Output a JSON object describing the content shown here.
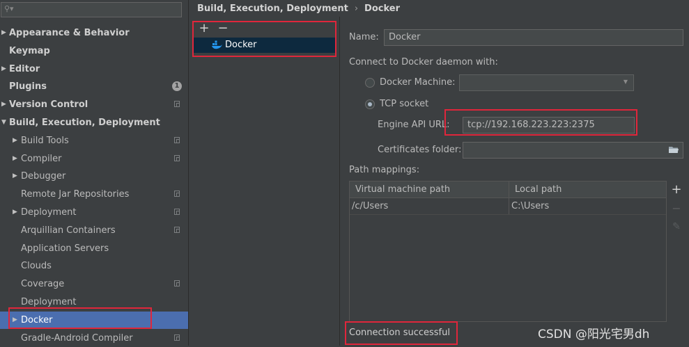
{
  "search": {
    "placeholder": ""
  },
  "sidebar": {
    "items": [
      {
        "label": "Appearance & Behavior",
        "bold": true,
        "arrow": "right",
        "indent": 0
      },
      {
        "label": "Keymap",
        "bold": true,
        "arrow": "",
        "indent": 0
      },
      {
        "label": "Editor",
        "bold": true,
        "arrow": "right",
        "indent": 0
      },
      {
        "label": "Plugins",
        "bold": true,
        "arrow": "",
        "indent": 0,
        "badge": "1"
      },
      {
        "label": "Version Control",
        "bold": true,
        "arrow": "right",
        "indent": 0,
        "copy_icon": true
      },
      {
        "label": "Build, Execution, Deployment",
        "bold": true,
        "arrow": "down",
        "indent": 0
      },
      {
        "label": "Build Tools",
        "bold": false,
        "arrow": "right",
        "indent": 1,
        "copy_icon": true
      },
      {
        "label": "Compiler",
        "bold": false,
        "arrow": "right",
        "indent": 1,
        "copy_icon": true
      },
      {
        "label": "Debugger",
        "bold": false,
        "arrow": "right",
        "indent": 1
      },
      {
        "label": "Remote Jar Repositories",
        "bold": false,
        "arrow": "",
        "indent": 1,
        "copy_icon": true
      },
      {
        "label": "Deployment",
        "bold": false,
        "arrow": "right",
        "indent": 1,
        "copy_icon": true
      },
      {
        "label": "Arquillian Containers",
        "bold": false,
        "arrow": "",
        "indent": 1,
        "copy_icon": true
      },
      {
        "label": "Application Servers",
        "bold": false,
        "arrow": "",
        "indent": 1
      },
      {
        "label": "Clouds",
        "bold": false,
        "arrow": "",
        "indent": 1
      },
      {
        "label": "Coverage",
        "bold": false,
        "arrow": "",
        "indent": 1,
        "copy_icon": true
      },
      {
        "label": "Deployment",
        "bold": false,
        "arrow": "",
        "indent": 1
      },
      {
        "label": "Docker",
        "bold": false,
        "arrow": "right",
        "indent": 1,
        "selected": true
      },
      {
        "label": "Gradle-Android Compiler",
        "bold": false,
        "arrow": "",
        "indent": 1,
        "copy_icon": true
      }
    ]
  },
  "breadcrumb": {
    "parent": "Build, Execution, Deployment",
    "separator": "›",
    "current": "Docker"
  },
  "toolbar": {
    "add_label": "+",
    "remove_label": "−"
  },
  "docker_list": {
    "item_label": "Docker"
  },
  "form": {
    "name_label": "Name:",
    "name_value": "Docker",
    "connect_label": "Connect to Docker daemon with:",
    "docker_machine_label": "Docker Machine:",
    "docker_machine_value": "",
    "tcp_socket_label": "TCP socket",
    "engine_api_url_label": "Engine API URL:",
    "engine_api_url_value": "tcp://192.168.223.223:2375",
    "certificates_folder_label": "Certificates folder:",
    "certificates_folder_value": "",
    "path_mappings_label": "Path mappings:"
  },
  "path_table": {
    "columns": [
      "Virtual machine path",
      "Local path"
    ],
    "rows": [
      [
        "/c/Users",
        "C:\\Users"
      ]
    ],
    "buttons": {
      "add": "+",
      "remove": "−",
      "edit": "✎"
    }
  },
  "status": {
    "text": "Connection successful"
  },
  "watermark": {
    "text": "CSDN @阳光宅男dh"
  },
  "colors": {
    "background": "#3c3f41",
    "selection": "#4b6eaf",
    "list_selection": "#0d293e",
    "highlight_box": "#e0263b",
    "docker_icon": "#2496ed"
  }
}
